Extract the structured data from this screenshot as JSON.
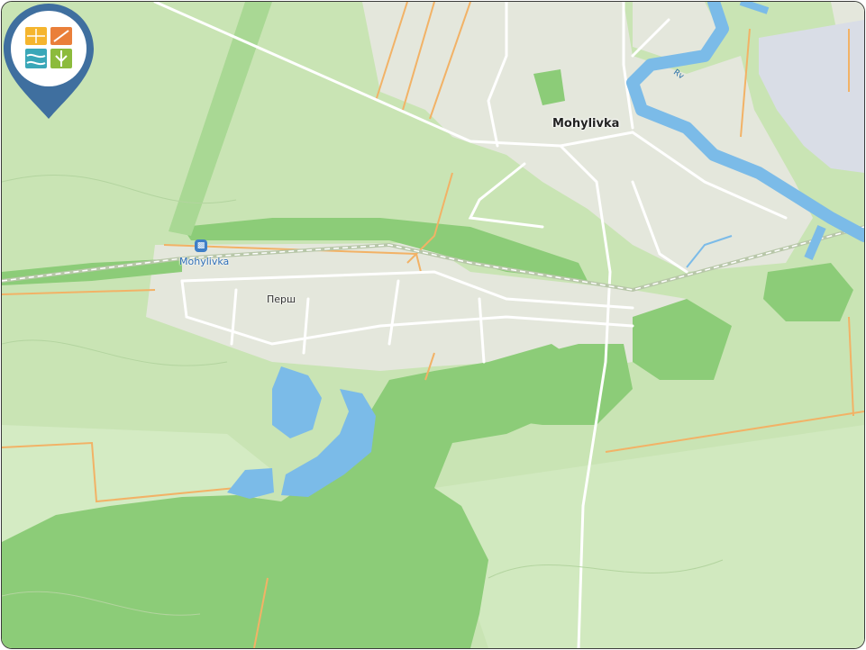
{
  "map": {
    "town_label": "Mohylivka",
    "station_label": "Mohylivka",
    "street_label": "Перш",
    "river_label": "Rv",
    "station_icon": "train-station-icon",
    "marker_icon": "location-pin-logo-icon",
    "colors": {
      "forest_light": "#c9e4b4",
      "forest_dark": "#8ccc78",
      "settlement": "#e4e7dc",
      "water": "#7bbbe8",
      "water_large": "#d9dde6",
      "road_minor": "#ffffff",
      "road_secondary": "#f2b266",
      "marker": "#3f6f9f"
    }
  }
}
